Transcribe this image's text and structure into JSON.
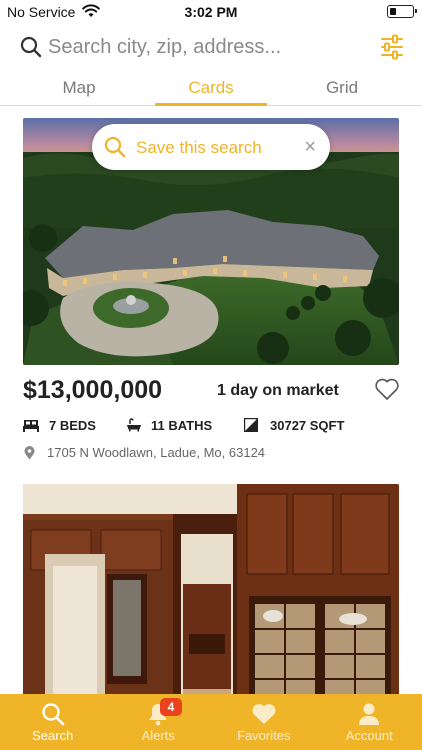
{
  "status_bar": {
    "carrier": "No Service",
    "time": "3:02 PM",
    "battery_level": 0.3
  },
  "search": {
    "placeholder": "Search city, zip, address...",
    "icon": "search-icon",
    "filter_icon": "sliders-icon"
  },
  "tabs": [
    {
      "label": "Map",
      "active": false
    },
    {
      "label": "Cards",
      "active": true
    },
    {
      "label": "Grid",
      "active": false
    }
  ],
  "save_search": {
    "label": "Save this search",
    "close_glyph": "×"
  },
  "listing": {
    "price": "$13,000,000",
    "days_on_market": "1 day on market",
    "beds": "7 BEDS",
    "baths": "11 BATHS",
    "sqft": "30727 SQFT",
    "address": "1705 N Woodlawn, Ladue, Mo, 63124"
  },
  "bottom_nav": {
    "items": [
      {
        "label": "Search",
        "icon": "search-icon",
        "active": true
      },
      {
        "label": "Alerts",
        "icon": "bell-icon",
        "active": false,
        "badge": "4"
      },
      {
        "label": "Favorites",
        "icon": "heart-icon",
        "active": false
      },
      {
        "label": "Account",
        "icon": "person-icon",
        "active": false
      }
    ]
  },
  "colors": {
    "accent": "#f0b429",
    "badge": "#e8421f",
    "text": "#222222",
    "muted": "#7a7a7a"
  }
}
